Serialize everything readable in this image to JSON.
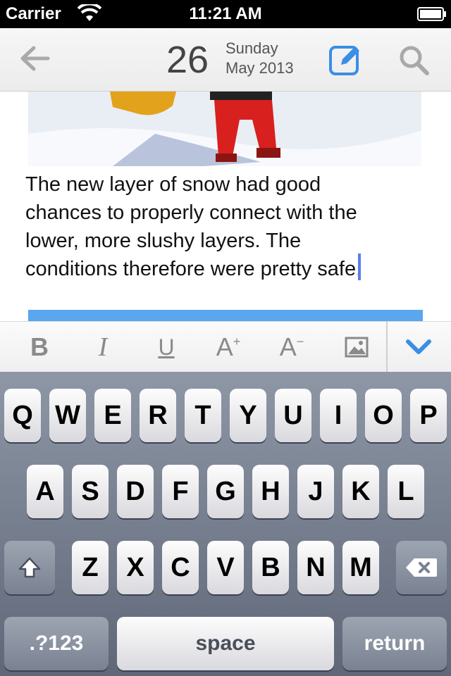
{
  "status_bar": {
    "carrier": "Carrier",
    "time": "11:21 AM"
  },
  "nav_bar": {
    "day_number": "26",
    "weekday": "Sunday",
    "month_year": "May 2013",
    "back_icon": "arrow-left-icon",
    "compose_icon": "compose-edit-icon",
    "search_icon": "magnifier-icon",
    "accent_color": "#3a8ee6"
  },
  "note": {
    "lines": [
      "The new layer of snow had good",
      "chances to properly connect with the",
      "lower, more slushy layers. The",
      "conditions therefore were pretty safe."
    ]
  },
  "format_toolbar": {
    "bold": "B",
    "italic": "I",
    "underline": "U",
    "grow_letter": "A",
    "grow_sign": "+",
    "shrink_letter": "A",
    "shrink_sign": "−",
    "image_icon": "image-icon",
    "hide_keyboard_icon": "chevron-down-icon"
  },
  "keyboard": {
    "row1": [
      "Q",
      "W",
      "E",
      "R",
      "T",
      "Y",
      "U",
      "I",
      "O",
      "P"
    ],
    "row2": [
      "A",
      "S",
      "D",
      "F",
      "G",
      "H",
      "J",
      "K",
      "L"
    ],
    "row3": [
      "Z",
      "X",
      "C",
      "V",
      "B",
      "N",
      "M"
    ],
    "numbers_label": ".?123",
    "space_label": "space",
    "return_label": "return",
    "shift_icon": "shift-icon",
    "delete_icon": "backspace-icon"
  }
}
